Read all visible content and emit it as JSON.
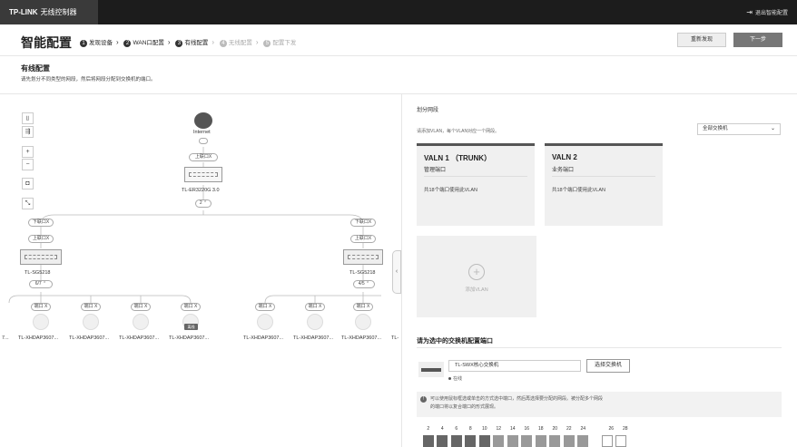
{
  "app": {
    "brand": "TP-LINK",
    "product": "无线控制器",
    "exit_label": "退出智能配置"
  },
  "header": {
    "title": "智能配置",
    "steps": [
      {
        "num": "1",
        "label": "发现设备"
      },
      {
        "num": "2",
        "label": "WAN口配置"
      },
      {
        "num": "3",
        "label": "有线配置"
      },
      {
        "num": "4",
        "label": "无线配置"
      },
      {
        "num": "5",
        "label": "配置下发"
      }
    ],
    "rediscover_label": "重新发现",
    "next_label": "下一步"
  },
  "section": {
    "title": "有线配置",
    "desc": "请先划分不同类型的网段，然后将网段分配到交换机的端口。"
  },
  "topology": {
    "internet_label": "Internet",
    "uplink_label": "上联口X",
    "downlink_label": "下联口X",
    "port_label": "端口 X",
    "router": {
      "name": "TL-ER3220G 3.0",
      "count": "2"
    },
    "switches": [
      {
        "name": "TL-SG5218",
        "count": "6/7"
      },
      {
        "name": "TL-SG5218",
        "count": "4/5"
      }
    ],
    "aps": [
      "TL-XHDAP3607...",
      "TL-XHDAP3607...",
      "TL-XHDAP3607...",
      "TL-XHDAP3607...",
      "TL-XHDAP3607...",
      "TL-XHDAP3607...",
      "TL-XHDAP3607..."
    ],
    "ap_left_cut": "7...",
    "ap_right_cut": "TL-",
    "offline_badge": "离线",
    "tools": [
      "fit-icon",
      "layout-icon",
      "zoom-in-icon",
      "zoom-out-icon",
      "camera-icon",
      "expand-icon"
    ]
  },
  "vlan_panel": {
    "title": "划分网段",
    "hint": "请添加VLAN，每个VLAN对应一个网段。",
    "filter": "全部交换机",
    "cards": [
      {
        "name": "VALN 1 （TRUNK）",
        "type": "管理端口",
        "ports": "共18个端口使用此VLAN"
      },
      {
        "name": "VALN 2",
        "type": "业务端口",
        "ports": "共18个端口使用此VLAN"
      }
    ],
    "add_label": "添加VLAN"
  },
  "config": {
    "title": "请为选中的交换机配置端口",
    "switch_name": "TL-SWX核心交换机",
    "select_btn": "选择交换机",
    "status": "在线",
    "info": [
      "可以使用鼠标框选或单击的方式选中端口，然后再选择要分配的网段。被分配多个网段",
      "的端口将以复合端口的形式展现。"
    ],
    "port_numbers": [
      "2",
      "4",
      "6",
      "8",
      "10",
      "12",
      "14",
      "16",
      "18",
      "20",
      "22",
      "24",
      "",
      "26",
      "28"
    ]
  }
}
